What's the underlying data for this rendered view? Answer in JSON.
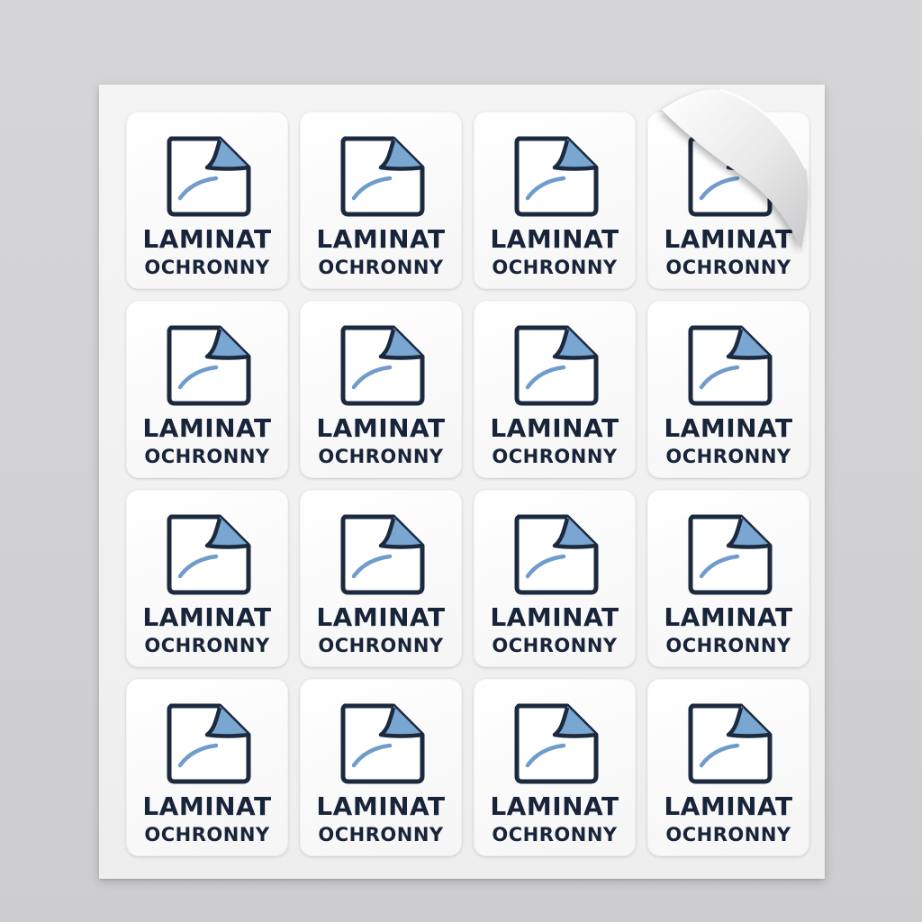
{
  "sticker_sheet": {
    "rows": 4,
    "columns": 4,
    "label_line_1": "LAMINAT",
    "label_line_2": "OCHRONNY",
    "icon": "peeling-page-icon",
    "colors": {
      "outline": "#1c2a3f",
      "accent": "#7aa6d2",
      "sticker": "#ffffff",
      "background": "#d3d3d5"
    },
    "peeled_corner": "top-right sticker, top-right corner"
  }
}
